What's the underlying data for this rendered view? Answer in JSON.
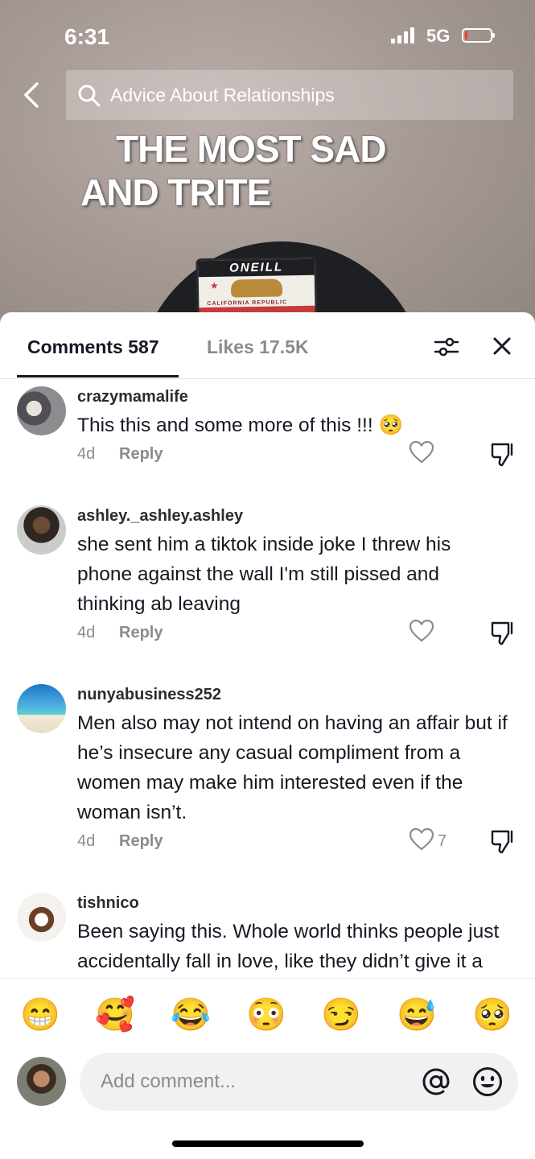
{
  "status_bar": {
    "time": "6:31",
    "network": "5G",
    "battery_level": 0.1
  },
  "search": {
    "query": "Advice About Relationships"
  },
  "video": {
    "overlay_line1": "THE MOST SAD",
    "overlay_line2": "AND TRITE",
    "cap_brand": "ONEILL",
    "patch_text": "CALIFORNIA REPUBLIC"
  },
  "tabs": {
    "comments_label": "Comments 587",
    "likes_label": "Likes 17.5K"
  },
  "comments": [
    {
      "username": "crazymamalife",
      "text": "This this and some more of this !!! 🥺",
      "age": "4d",
      "reply_label": "Reply",
      "like_count": ""
    },
    {
      "username": "ashley._ashley.ashley",
      "text": "she sent him a tiktok inside joke I threw his phone against the wall I'm still pissed and thinking ab leaving",
      "age": "4d",
      "reply_label": "Reply",
      "like_count": ""
    },
    {
      "username": "nunyabusiness252",
      "text": "Men also may not intend on having an affair but if he’s insecure any casual compliment from a women may make him interested even if the woman isn’t.",
      "age": "4d",
      "reply_label": "Reply",
      "like_count": "7"
    },
    {
      "username": "tishnico",
      "text": "Been saying this. Whole world thinks people just accidentally fall in love, like they didn’t give it a million opportunities",
      "age": "",
      "reply_label": "",
      "like_count": ""
    }
  ],
  "quick_emojis": [
    "😁",
    "🥰",
    "😂",
    "😳",
    "😏",
    "😅",
    "🥺"
  ],
  "compose": {
    "placeholder": "Add comment..."
  },
  "colors": {
    "primary_text": "#161823",
    "secondary_text": "#8a8b91",
    "battery_low": "#ff3b30",
    "input_bg": "#f1f1f2"
  }
}
